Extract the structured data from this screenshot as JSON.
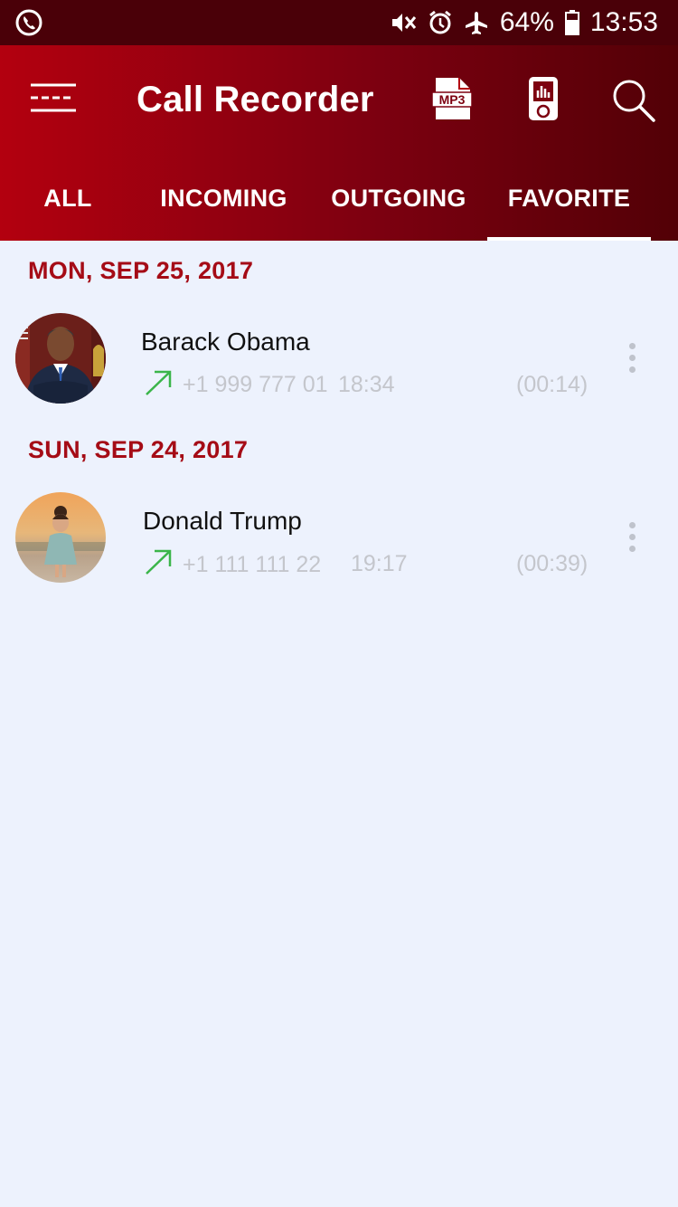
{
  "status_bar": {
    "battery": "64%",
    "time": "13:53",
    "icons": [
      "call-icon",
      "mute-icon",
      "alarm-icon",
      "airplane-icon",
      "battery-icon"
    ]
  },
  "app_bar": {
    "title": "Call Recorder",
    "mp3_label": "MP3",
    "icons": [
      "menu-icon",
      "mp3-icon",
      "player-icon",
      "search-icon"
    ]
  },
  "tabs": [
    {
      "label": "ALL",
      "active": false
    },
    {
      "label": "INCOMING",
      "active": false
    },
    {
      "label": "OUTGOING",
      "active": false
    },
    {
      "label": "FAVORITE",
      "active": true
    }
  ],
  "groups": [
    {
      "date": "MON, SEP 25, 2017",
      "calls": [
        {
          "name": "Barack Obama",
          "number": "+1 999 777 01",
          "time": "18:34",
          "duration": "(00:14)",
          "direction": "outgoing"
        }
      ]
    },
    {
      "date": "SUN, SEP 24, 2017",
      "calls": [
        {
          "name": "Donald Trump",
          "number": "+1 111 111 22",
          "time": "19:17",
          "duration": "(00:39)",
          "direction": "outgoing"
        }
      ]
    }
  ],
  "colors": {
    "appbar_start": "#b3000f",
    "appbar_end": "#520006",
    "date_header": "#a50c16",
    "outgoing_arrow": "#3bb54a",
    "background": "#edf2fd"
  }
}
